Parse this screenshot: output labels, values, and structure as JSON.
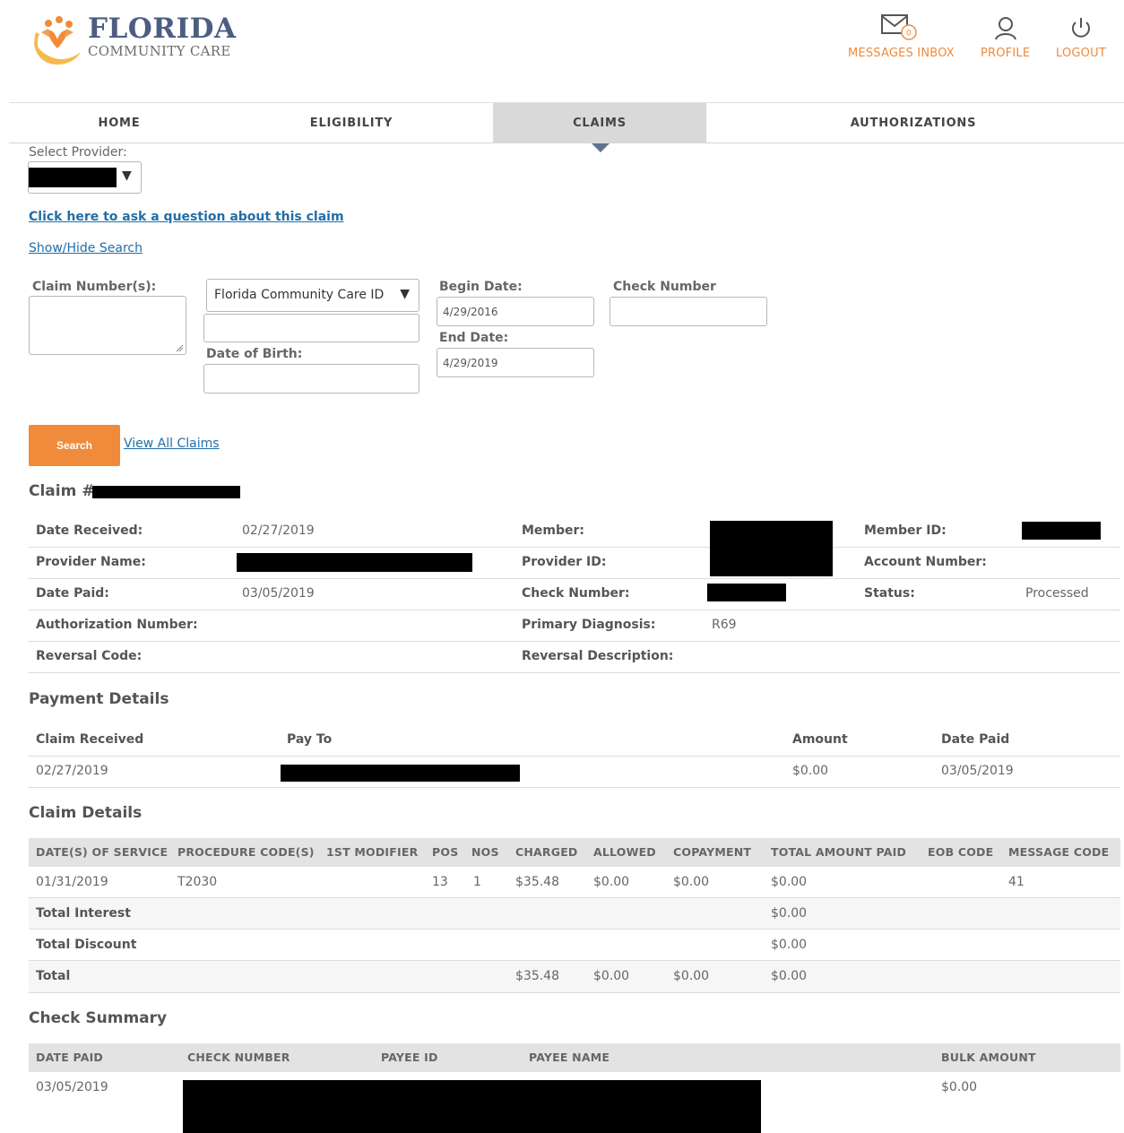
{
  "brand": {
    "line1": "FLORIDA",
    "line2": "COMMUNITY CARE",
    "accent": "#ef8b3a",
    "navy": "#4d5d82"
  },
  "header": {
    "messages_label": "MESSAGES INBOX",
    "messages_count": "0",
    "profile_label": "PROFILE",
    "logout_label": "LOGOUT"
  },
  "nav": {
    "home": "HOME",
    "eligibility": "ELIGIBILITY",
    "claims": "CLAIMS",
    "authorizations": "AUTHORIZATIONS",
    "active": "CLAIMS"
  },
  "search": {
    "select_provider_label": "Select Provider:",
    "ask_question_link": "Click here to ask a question about this claim",
    "show_hide_link": "Show/Hide Search",
    "claim_numbers_label": "Claim Number(s):",
    "id_type_selected": "Florida Community Care ID",
    "dob_label": "Date of Birth:",
    "begin_date_label": "Begin Date:",
    "begin_date_value": "4/29/2016",
    "end_date_label": "End Date:",
    "end_date_value": "4/29/2019",
    "check_number_label": "Check Number",
    "search_button": "Search",
    "view_all_link": "View All Claims"
  },
  "claim": {
    "title_prefix": "Claim #",
    "fields": {
      "date_received_label": "Date Received:",
      "date_received": "02/27/2019",
      "member_label": "Member:",
      "member_id_label": "Member ID:",
      "provider_name_label": "Provider Name:",
      "provider_id_label": "Provider ID:",
      "account_number_label": "Account Number:",
      "date_paid_label": "Date Paid:",
      "date_paid": "03/05/2019",
      "check_number_label": "Check Number:",
      "status_label": "Status:",
      "status": "Processed",
      "authorization_label": "Authorization Number:",
      "primary_diagnosis_label": "Primary Diagnosis:",
      "primary_diagnosis": "R69",
      "reversal_code_label": "Reversal Code:",
      "reversal_description_label": "Reversal Description:"
    }
  },
  "payment_details": {
    "title": "Payment Details",
    "headers": [
      "Claim Received",
      "Pay To",
      "Amount",
      "Date Paid"
    ],
    "row": {
      "claim_received": "02/27/2019",
      "amount": "$0.00",
      "date_paid": "03/05/2019"
    }
  },
  "claim_details": {
    "title": "Claim Details",
    "headers": [
      "DATE(S) OF SERVICE",
      "PROCEDURE CODE(S)",
      "1ST MODIFIER",
      "POS",
      "NOS",
      "CHARGED",
      "ALLOWED",
      "COPAYMENT",
      "TOTAL AMOUNT PAID",
      "EOB CODE",
      "MESSAGE CODE"
    ],
    "line": {
      "dos": "01/31/2019",
      "proc": "T2030",
      "pos": "13",
      "nos": "1",
      "charged": "$35.48",
      "allowed": "$0.00",
      "copay": "$0.00",
      "paid": "$0.00",
      "message": "41"
    },
    "interest": {
      "label": "Total Interest",
      "paid": "$0.00"
    },
    "discount": {
      "label": "Total Discount",
      "paid": "$0.00"
    },
    "total": {
      "label": "Total",
      "charged": "$35.48",
      "allowed": "$0.00",
      "copay": "$0.00",
      "paid": "$0.00"
    }
  },
  "check_summary": {
    "title": "Check Summary",
    "headers": [
      "DATE PAID",
      "CHECK NUMBER",
      "PAYEE ID",
      "PAYEE NAME",
      "BULK AMOUNT"
    ],
    "row": {
      "date_paid": "03/05/2019",
      "bulk_amount": "$0.00"
    }
  }
}
